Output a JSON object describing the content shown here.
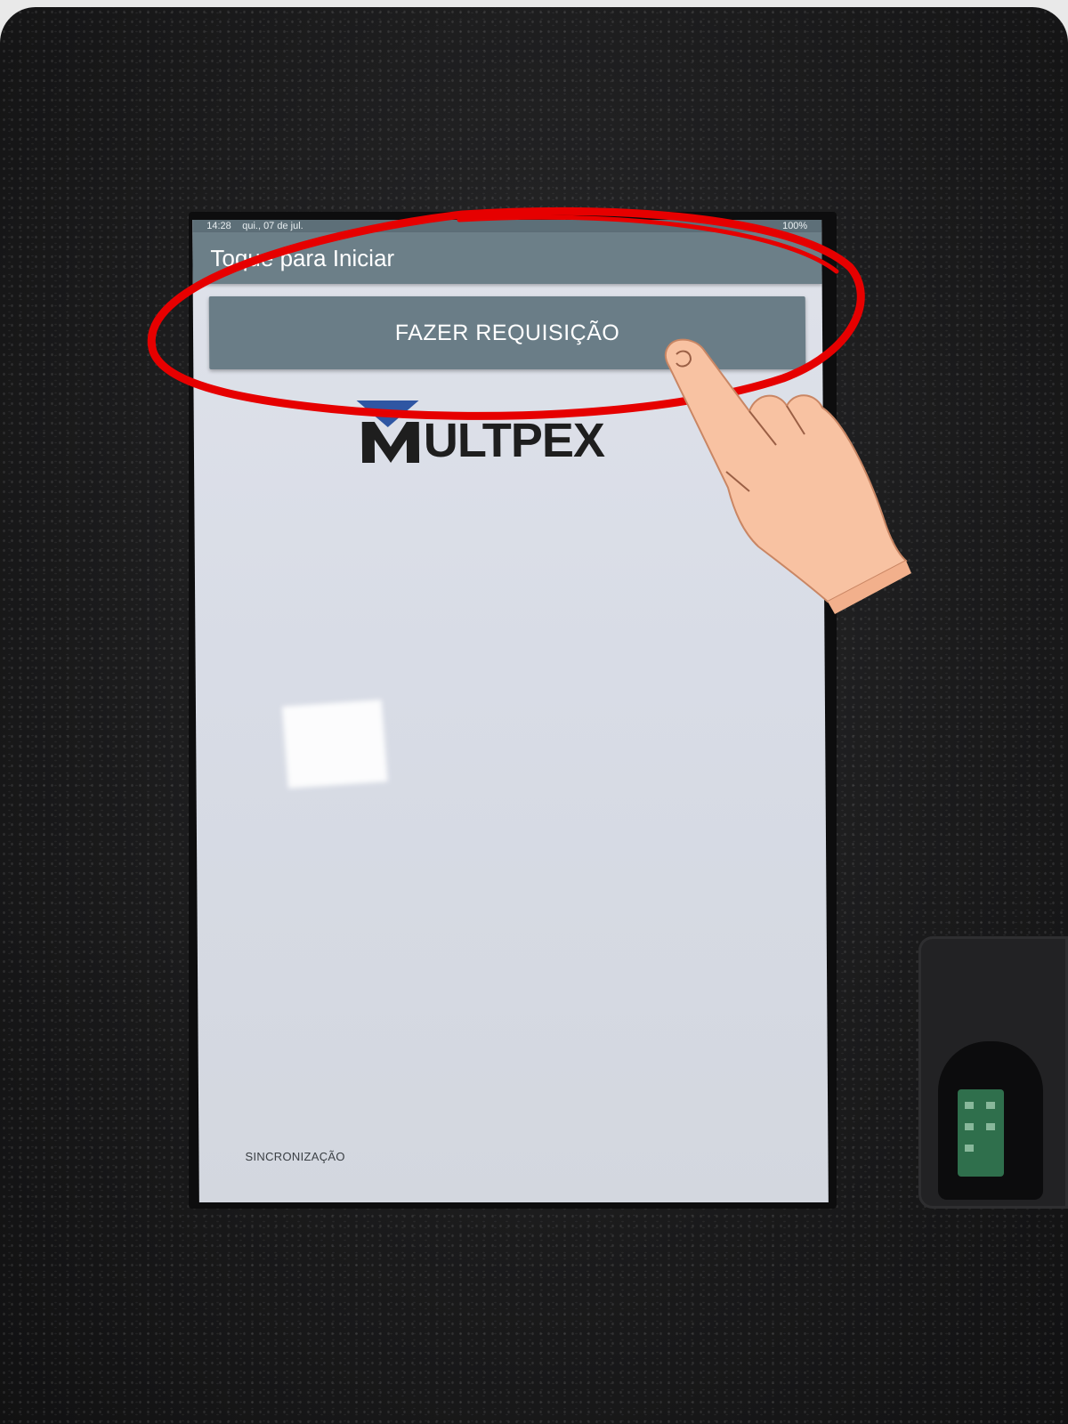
{
  "status_bar": {
    "time": "14:28",
    "date": "qui., 07 de jul.",
    "battery": "100%"
  },
  "app_bar": {
    "title": "Toque para Iniciar"
  },
  "main": {
    "request_button_label": "FAZER REQUISIÇÃO"
  },
  "logo": {
    "text": "MULTPEX",
    "colors": {
      "blue": "#2f56a3",
      "dark": "#1e1e1e"
    }
  },
  "footer": {
    "sync_label": "SINCRONIZAÇÃO"
  },
  "annotation": {
    "circle_color": "#e60000",
    "pointer": "hand-pointer-icon"
  },
  "colors": {
    "app_bar": "#6c7f88",
    "button": "#6a7d87",
    "screen_bg": "#dbdfe7"
  }
}
